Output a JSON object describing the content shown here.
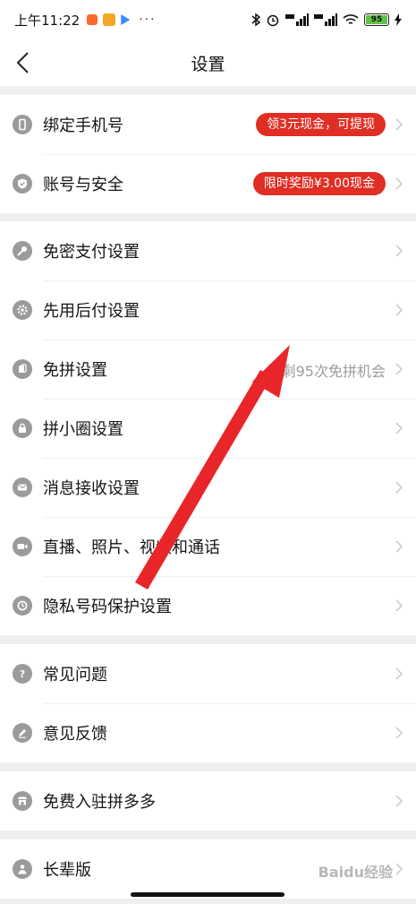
{
  "status_bar": {
    "time": "上午11:22",
    "dots": "···",
    "battery": "95"
  },
  "nav": {
    "title": "设置"
  },
  "groups": [
    [
      {
        "label": "绑定手机号",
        "badge": "领3元现金，可提现",
        "icon": "phone-icon"
      },
      {
        "label": "账号与安全",
        "badge": "限时奖励¥3.00现金",
        "icon": "shield-icon"
      }
    ],
    [
      {
        "label": "免密支付设置",
        "icon": "key-icon"
      },
      {
        "label": "先用后付设置",
        "icon": "gear-icon"
      },
      {
        "label": "免拼设置",
        "hint": "还剩95次免拼机会",
        "icon": "cards-icon"
      },
      {
        "label": "拼小圈设置",
        "icon": "lock-icon"
      },
      {
        "label": "消息接收设置",
        "icon": "mail-icon"
      },
      {
        "label": "直播、照片、视频和通话",
        "icon": "camera-icon"
      },
      {
        "label": "隐私号码保护设置",
        "icon": "clock-icon"
      }
    ],
    [
      {
        "label": "常见问题",
        "icon": "question-icon"
      },
      {
        "label": "意见反馈",
        "icon": "pen-icon"
      }
    ],
    [
      {
        "label": "免费入驻拼多多",
        "icon": "store-icon"
      }
    ],
    [
      {
        "label": "长辈版",
        "icon": "elder-icon"
      }
    ]
  ],
  "watermark": "Baidu经验",
  "colors": {
    "badge": "#e02e24",
    "icon": "#9b9b9b",
    "annotation_arrow": "#e8262a"
  }
}
